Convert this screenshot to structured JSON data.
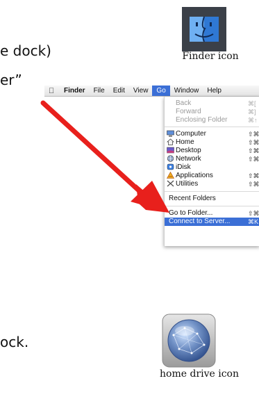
{
  "instructions": {
    "line1_fragment": "e dock)",
    "line2_fragment": "er”",
    "line3_fragment": "ock."
  },
  "finder_icon": {
    "caption": "Finder icon"
  },
  "menubar": {
    "items": [
      "Finder",
      "File",
      "Edit",
      "View",
      "Go",
      "Window",
      "Help"
    ]
  },
  "go_menu": {
    "items": [
      {
        "label": "Back",
        "shortcut": "⌘[",
        "icon": "",
        "state": "disabled"
      },
      {
        "label": "Forward",
        "shortcut": "⌘]",
        "icon": "",
        "state": "disabled"
      },
      {
        "label": "Enclosing Folder",
        "shortcut": "⌘↑",
        "icon": "",
        "state": "disabled"
      },
      {
        "label": "Computer",
        "shortcut": "⇧⌘C",
        "icon": "computer-icon",
        "state": "normal"
      },
      {
        "label": "Home",
        "shortcut": "⇧⌘H",
        "icon": "home-icon",
        "state": "normal"
      },
      {
        "label": "Desktop",
        "shortcut": "⇧⌘D",
        "icon": "desktop-icon",
        "state": "normal"
      },
      {
        "label": "Network",
        "shortcut": "⇧⌘K",
        "icon": "network-icon",
        "state": "normal"
      },
      {
        "label": "iDisk",
        "shortcut": "",
        "icon": "idisk-icon",
        "state": "normal"
      },
      {
        "label": "Applications",
        "shortcut": "⇧⌘A",
        "icon": "applications-icon",
        "state": "normal"
      },
      {
        "label": "Utilities",
        "shortcut": "⇧⌘U",
        "icon": "utilities-icon",
        "state": "normal"
      },
      {
        "label": "Recent Folders",
        "shortcut": "",
        "icon": "",
        "state": "normal"
      },
      {
        "label": "Go to Folder...",
        "shortcut": "⇧⌘G",
        "icon": "",
        "state": "normal"
      },
      {
        "label": "Connect to Server...",
        "shortcut": "⌘K",
        "icon": "",
        "state": "highlighted"
      }
    ]
  },
  "home_drive_icon": {
    "caption": "home drive icon"
  },
  "colors": {
    "highlight": "#3b6fd6",
    "arrow": "#e8201c",
    "finder_face_blue": "#4a8fe0"
  }
}
